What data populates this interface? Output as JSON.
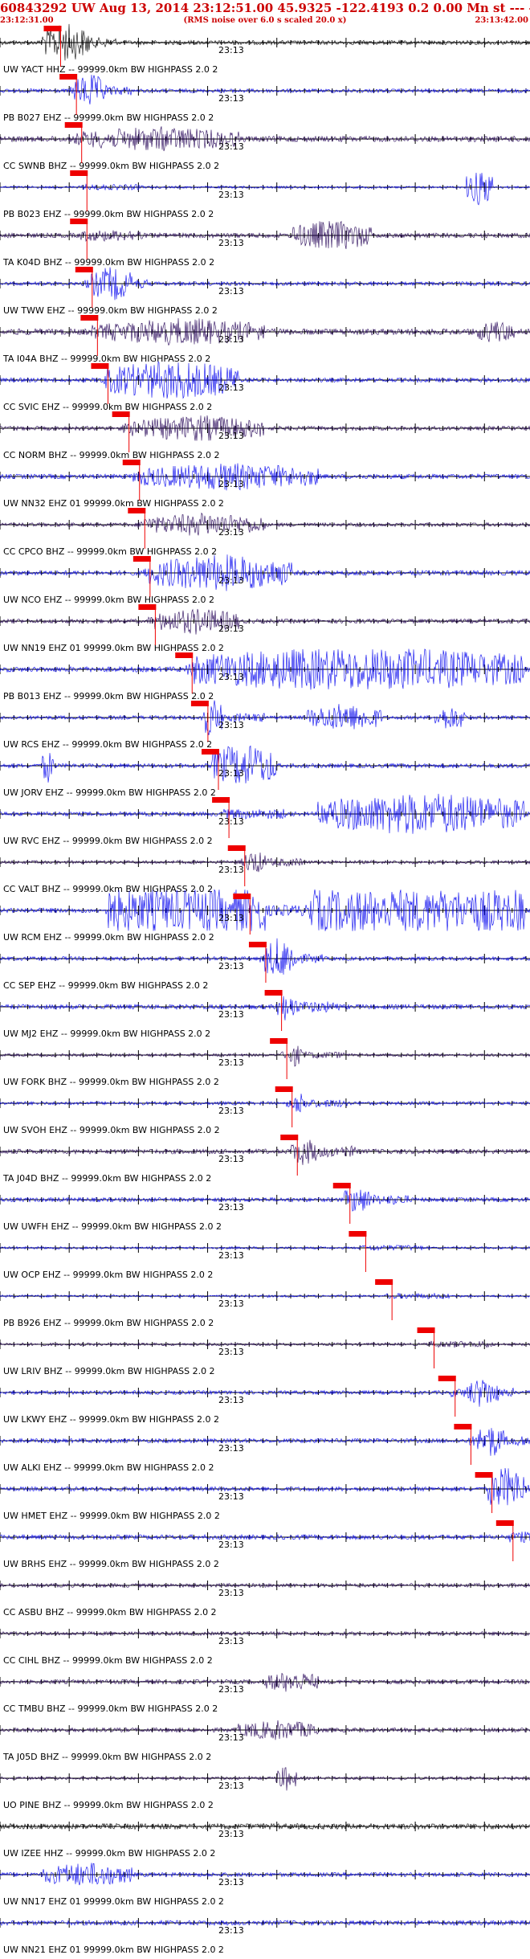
{
  "header": {
    "title": "60843292 UW Aug 13, 2014 23:12:51.00   45.9325 -122.4193  0.2 0.00 Mn st --- -- --  -1",
    "start_time": "23:12:31.00",
    "note": "(RMS noise over 6.0 s scaled 20.0 x)",
    "end_time": "23:13:42.00"
  },
  "colors": {
    "trace_primary": "#0000ee",
    "trace_secondary": "#220055",
    "trace_black": "#000000",
    "pick_marker": "#ee0000",
    "axis": "#000000",
    "header_text": "#cc0000"
  },
  "chart_data": {
    "type": "line",
    "title": "60843292 UW Aug 13, 2014 23:12:51.00",
    "xlim": [
      "23:12:31.00",
      "23:13:42.00"
    ],
    "tick_label": "23:13",
    "channels": [
      {
        "label": "UW YACT HHZ -- 99999.0km BW  HIGHPASS  2.0  2",
        "pick": 0.1,
        "color": "black",
        "amp": 0.9,
        "bursts": [
          [
            0.08,
            0.17,
            2.5
          ]
        ]
      },
      {
        "label": "PB B027 EHZ -- 99999.0km BW  HIGHPASS  2.0  2",
        "pick": 0.13,
        "color": "primary",
        "amp": 0.8,
        "bursts": [
          [
            0.14,
            0.2,
            2.2
          ]
        ]
      },
      {
        "label": "CC SWNB BHZ -- 99999.0km BW  HIGHPASS  2.0  2",
        "pick": 0.14,
        "color": "secondary",
        "amp": 1.2,
        "bursts": [
          [
            0.15,
            0.45,
            1.6
          ]
        ]
      },
      {
        "label": "PB B023 EHZ -- 99999.0km BW  HIGHPASS  2.0  2",
        "pick": 0.15,
        "color": "primary",
        "amp": 0.5,
        "bursts": [
          [
            0.88,
            0.93,
            2.4
          ]
        ]
      },
      {
        "label": "TA K04D BHZ -- 99999.0km BW  HIGHPASS  2.0  2",
        "pick": 0.15,
        "color": "secondary",
        "amp": 1.0,
        "bursts": [
          [
            0.55,
            0.7,
            2.0
          ]
        ]
      },
      {
        "label": "UW TWW EHZ -- 99999.0km BW  HIGHPASS  2.0  2",
        "pick": 0.16,
        "color": "primary",
        "amp": 0.8,
        "bursts": [
          [
            0.17,
            0.25,
            2.2
          ]
        ]
      },
      {
        "label": "TA I04A BHZ -- 99999.0km BW  HIGHPASS  2.0  2",
        "pick": 0.17,
        "color": "secondary",
        "amp": 1.3,
        "bursts": [
          [
            0.2,
            0.5,
            1.8
          ],
          [
            0.9,
            0.97,
            1.5
          ]
        ]
      },
      {
        "label": "CC SVIC EHZ -- 99999.0km BW  HIGHPASS  2.0  2",
        "pick": 0.19,
        "color": "primary",
        "amp": 0.9,
        "bursts": [
          [
            0.2,
            0.45,
            2.6
          ]
        ]
      },
      {
        "label": "CC NORM BHZ -- 99999.0km BW  HIGHPASS  2.0  2",
        "pick": 0.23,
        "color": "secondary",
        "amp": 0.9,
        "bursts": [
          [
            0.25,
            0.5,
            1.7
          ]
        ]
      },
      {
        "label": "UW NN32 EHZ 01 99999.0km BW  HIGHPASS  2.0  2",
        "pick": 0.25,
        "color": "primary",
        "amp": 1.0,
        "bursts": [
          [
            0.26,
            0.6,
            1.8
          ]
        ]
      },
      {
        "label": "CC CPCO BHZ -- 99999.0km BW  HIGHPASS  2.0  2",
        "pick": 0.26,
        "color": "secondary",
        "amp": 0.8,
        "bursts": [
          [
            0.27,
            0.5,
            1.5
          ]
        ]
      },
      {
        "label": "UW NCO EHZ -- 99999.0km BW  HIGHPASS  2.0  2",
        "pick": 0.27,
        "color": "primary",
        "amp": 1.0,
        "bursts": [
          [
            0.28,
            0.55,
            2.4
          ]
        ]
      },
      {
        "label": "UW NN19 EHZ 01 99999.0km BW  HIGHPASS  2.0  2",
        "pick": 0.28,
        "color": "secondary",
        "amp": 0.9,
        "bursts": [
          [
            0.29,
            0.45,
            1.7
          ]
        ]
      },
      {
        "label": "PB B013 EHZ -- 99999.0km BW  HIGHPASS  2.0  2",
        "pick": 0.35,
        "color": "primary",
        "amp": 1.1,
        "bursts": [
          [
            0.36,
            0.99,
            3.0
          ]
        ]
      },
      {
        "label": "UW RCS EHZ -- 99999.0km BW  HIGHPASS  2.0  2",
        "pick": 0.38,
        "color": "primary",
        "amp": 0.8,
        "bursts": [
          [
            0.38,
            0.42,
            2.6
          ],
          [
            0.58,
            0.72,
            1.8
          ],
          [
            0.82,
            0.88,
            1.6
          ]
        ]
      },
      {
        "label": "UW JORV EHZ -- 99999.0km BW  HIGHPASS  2.0  2",
        "pick": 0.4,
        "color": "primary",
        "amp": 0.9,
        "bursts": [
          [
            0.4,
            0.52,
            3.0
          ],
          [
            0.08,
            0.1,
            2.2
          ]
        ]
      },
      {
        "label": "UW RVC EHZ -- 99999.0km BW  HIGHPASS  2.0  2",
        "pick": 0.42,
        "color": "primary",
        "amp": 0.9,
        "bursts": [
          [
            0.6,
            0.99,
            2.8
          ]
        ]
      },
      {
        "label": "CC VALT BHZ -- 99999.0km BW  HIGHPASS  2.0  2",
        "pick": 0.45,
        "color": "secondary",
        "amp": 0.7,
        "bursts": [
          [
            0.46,
            0.5,
            1.6
          ]
        ]
      },
      {
        "label": "UW RCM EHZ -- 99999.0km BW  HIGHPASS  2.0  2",
        "pick": 0.46,
        "color": "primary",
        "amp": 1.0,
        "bursts": [
          [
            0.2,
            0.5,
            5.0
          ],
          [
            0.58,
            0.99,
            5.0
          ]
        ]
      },
      {
        "label": "CC SEP EHZ -- 99999.0km BW  HIGHPASS  2.0  2",
        "pick": 0.49,
        "color": "primary",
        "amp": 0.8,
        "bursts": [
          [
            0.5,
            0.56,
            2.8
          ]
        ]
      },
      {
        "label": "UW MJ2 EHZ -- 99999.0km BW  HIGHPASS  2.0  2",
        "pick": 0.52,
        "color": "primary",
        "amp": 1.0,
        "bursts": [
          [
            0.52,
            0.56,
            1.8
          ]
        ]
      },
      {
        "label": "UW FORK BHZ -- 99999.0km BW  HIGHPASS  2.0  2",
        "pick": 0.53,
        "color": "secondary",
        "amp": 0.6,
        "bursts": [
          [
            0.54,
            0.57,
            1.5
          ]
        ]
      },
      {
        "label": "UW SVOH EHZ -- 99999.0km BW  HIGHPASS  2.0  2",
        "pick": 0.54,
        "color": "primary",
        "amp": 0.7,
        "bursts": [
          [
            0.55,
            0.58,
            1.5
          ]
        ]
      },
      {
        "label": "TA J04D BHZ -- 99999.0km BW  HIGHPASS  2.0  2",
        "pick": 0.55,
        "color": "secondary",
        "amp": 1.0,
        "bursts": [
          [
            0.55,
            0.6,
            1.8
          ]
        ]
      },
      {
        "label": "UW UWFH EHZ -- 99999.0km BW  HIGHPASS  2.0  2",
        "pick": 0.65,
        "color": "primary",
        "amp": 0.9,
        "bursts": [
          [
            0.65,
            0.7,
            1.8
          ]
        ]
      },
      {
        "label": "UW OCP EHZ -- 99999.0km BW  HIGHPASS  2.0  2",
        "pick": 0.68,
        "color": "primary",
        "amp": 0.5,
        "bursts": []
      },
      {
        "label": "PB B926 EHZ -- 99999.0km BW  HIGHPASS  2.0  2",
        "pick": 0.73,
        "color": "primary",
        "amp": 0.5,
        "bursts": []
      },
      {
        "label": "UW LRIV BHZ -- 99999.0km BW  HIGHPASS  2.0  2",
        "pick": 0.81,
        "color": "secondary",
        "amp": 0.6,
        "bursts": []
      },
      {
        "label": "UW LKWY EHZ -- 99999.0km BW  HIGHPASS  2.0  2",
        "pick": 0.85,
        "color": "primary",
        "amp": 0.8,
        "bursts": [
          [
            0.88,
            0.94,
            2.0
          ]
        ]
      },
      {
        "label": "UW ALKI EHZ -- 99999.0km BW  HIGHPASS  2.0  2",
        "pick": 0.88,
        "color": "primary",
        "amp": 0.9,
        "bursts": [
          [
            0.9,
            0.95,
            2.2
          ]
        ]
      },
      {
        "label": "UW HMET EHZ -- 99999.0km BW  HIGHPASS  2.0  2",
        "pick": 0.92,
        "color": "primary",
        "amp": 0.9,
        "bursts": [
          [
            0.92,
            0.99,
            3.0
          ]
        ]
      },
      {
        "label": "UW BRHS EHZ -- 99999.0km BW  HIGHPASS  2.0  2",
        "pick": 0.96,
        "color": "primary",
        "amp": 1.0,
        "bursts": []
      },
      {
        "label": "CC ASBU BHZ -- 99999.0km BW  HIGHPASS  2.0  2",
        "pick": null,
        "color": "secondary",
        "amp": 0.8,
        "bursts": []
      },
      {
        "label": "CC CIHL BHZ -- 99999.0km BW  HIGHPASS  2.0  2",
        "pick": null,
        "color": "secondary",
        "amp": 0.8,
        "bursts": []
      },
      {
        "label": "CC TMBU BHZ -- 99999.0km BW  HIGHPASS  2.0  2",
        "pick": null,
        "color": "secondary",
        "amp": 0.9,
        "bursts": [
          [
            0.5,
            0.6,
            1.4
          ]
        ]
      },
      {
        "label": "TA J05D BHZ -- 99999.0km BW  HIGHPASS  2.0  2",
        "pick": null,
        "color": "secondary",
        "amp": 0.9,
        "bursts": [
          [
            0.45,
            0.6,
            1.3
          ]
        ]
      },
      {
        "label": "UO PINE BHZ -- 99999.0km BW  HIGHPASS  2.0  2",
        "pick": null,
        "color": "secondary",
        "amp": 0.6,
        "bursts": [
          [
            0.52,
            0.56,
            1.6
          ]
        ]
      },
      {
        "label": "UW IZEE HHZ -- 99999.0km BW  HIGHPASS  2.0  2",
        "pick": null,
        "color": "black",
        "amp": 1.2,
        "bursts": []
      },
      {
        "label": "UW NN17 EHZ 01 99999.0km BW  HIGHPASS  2.0  2",
        "pick": null,
        "color": "primary",
        "amp": 0.9,
        "bursts": [
          [
            0.08,
            0.25,
            1.6
          ]
        ]
      },
      {
        "label": "UW NN21 EHZ 01 99999.0km BW  HIGHPASS  2.0  2",
        "pick": null,
        "color": "primary",
        "amp": 1.0,
        "bursts": []
      }
    ]
  }
}
